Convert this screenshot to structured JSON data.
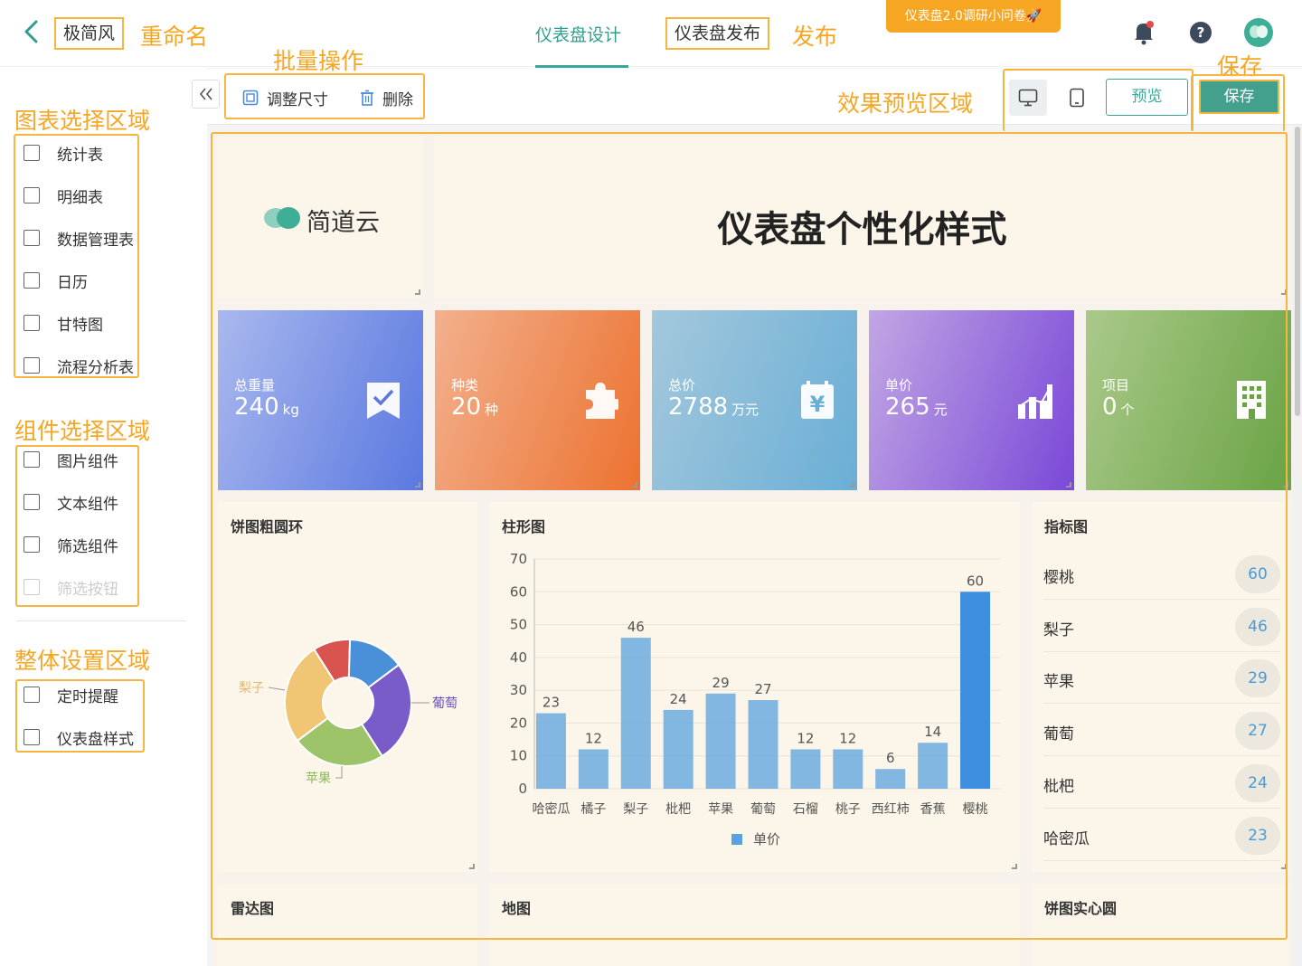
{
  "topbar": {
    "style_name": "极简风",
    "rename_anno": "重命名",
    "tabs": [
      "仪表盘设计",
      "仪表盘发布"
    ],
    "publish_anno": "发布",
    "survey_label": "仪表盘2.0调研小问卷🚀"
  },
  "annotations": {
    "batch": "批量操作",
    "chart_area": "图表选择区域",
    "component_area": "组件选择区域",
    "global_area": "整体设置区域",
    "preview_area": "效果预览区域",
    "save": "保存"
  },
  "chart_list": [
    "统计表",
    "明细表",
    "数据管理表",
    "日历",
    "甘特图",
    "流程分析表"
  ],
  "component_list": [
    "图片组件",
    "文本组件",
    "筛选组件",
    "筛选按钮"
  ],
  "global_list": [
    "定时提醒",
    "仪表盘样式"
  ],
  "toolbar": {
    "resize": "调整尺寸",
    "delete": "删除",
    "preview": "预览",
    "save": "保存"
  },
  "dashboard": {
    "logo_text": "简道云",
    "title": "仪表盘个性化样式",
    "stats": [
      {
        "label": "总重量",
        "value": "240",
        "unit": "kg",
        "icon": "check-flag-icon",
        "gradient": [
          "#a9b8ee",
          "#5a78e0"
        ]
      },
      {
        "label": "种类",
        "value": "20",
        "unit": "种",
        "icon": "puzzle-icon",
        "gradient": [
          "#f3b08d",
          "#ec7230"
        ]
      },
      {
        "label": "总价",
        "value": "2788",
        "unit": "万元",
        "icon": "yen-icon",
        "gradient": [
          "#a3c8dc",
          "#6aaed6"
        ]
      },
      {
        "label": "单价",
        "value": "265",
        "unit": "元",
        "icon": "bar-chart-icon",
        "gradient": [
          "#c1a6e4",
          "#7a48d8"
        ]
      },
      {
        "label": "项目",
        "value": "0",
        "unit": "个",
        "icon": "building-icon",
        "gradient": [
          "#aac98a",
          "#6aa344"
        ]
      }
    ],
    "donut_title": "饼图粗圆环",
    "bar_title": "柱形图",
    "indicator_title": "指标图",
    "indicators": [
      {
        "name": "樱桃",
        "value": "60"
      },
      {
        "name": "梨子",
        "value": "46"
      },
      {
        "name": "苹果",
        "value": "29"
      },
      {
        "name": "葡萄",
        "value": "27"
      },
      {
        "name": "枇杷",
        "value": "24"
      },
      {
        "name": "哈密瓜",
        "value": "23"
      }
    ],
    "bottom_titles": [
      "雷达图",
      "地图",
      "饼图实心圆"
    ]
  },
  "chart_data": [
    {
      "type": "bar",
      "title": "柱形图",
      "categories": [
        "哈密瓜",
        "橘子",
        "梨子",
        "枇杷",
        "苹果",
        "葡萄",
        "石榴",
        "桃子",
        "西红柿",
        "香蕉",
        "樱桃"
      ],
      "series": [
        {
          "name": "单价",
          "values": [
            23,
            12,
            46,
            24,
            29,
            27,
            12,
            12,
            6,
            14,
            60
          ]
        }
      ],
      "ylim": [
        0,
        70
      ],
      "yticks": [
        0,
        10,
        20,
        30,
        40,
        50,
        60,
        70
      ],
      "color": "#5aa2df",
      "highlight_color": "#3f8fe0"
    },
    {
      "type": "pie",
      "title": "饼图粗圆环",
      "labels": [
        "红色",
        "蓝色",
        "葡萄",
        "苹果",
        "梨子"
      ],
      "values": [
        4,
        6,
        11,
        10,
        11
      ],
      "colors": [
        "#d9534f",
        "#4a90d9",
        "#7a5cc8",
        "#9ec46a",
        "#f0c674"
      ],
      "shown_labels": [
        "梨子",
        "葡萄",
        "苹果"
      ]
    }
  ]
}
